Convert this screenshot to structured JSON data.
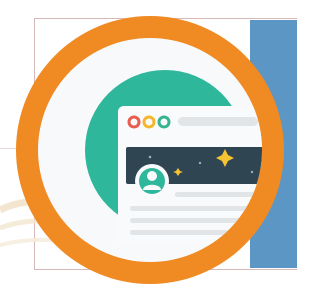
{
  "colors": {
    "page_background": "#ffffff",
    "frame_line": "#d8b9b9",
    "side_panel_blue": "#5b96c4",
    "background_swoosh": "#f0dfc4",
    "outer_ring_orange": "#f08a22",
    "inner_ring_white": "#f7f9fb",
    "teal_disc": "#2eb79a",
    "browser_window": "#f9fafb",
    "header_dark_navy": "#2f4552",
    "sparkle_gold": "#f5c430",
    "avatar_teal": "#2eb79a",
    "window_dot_red": "#e85b4e",
    "window_dot_yellow": "#f5b72a",
    "window_dot_green": "#37b38f",
    "placeholder_line_gray": "#e1e5e8"
  },
  "icons": {
    "emblem": "profile-page-browser-icon",
    "avatar": "user-avatar-icon",
    "sparkles": "star-sparkle-icon"
  }
}
